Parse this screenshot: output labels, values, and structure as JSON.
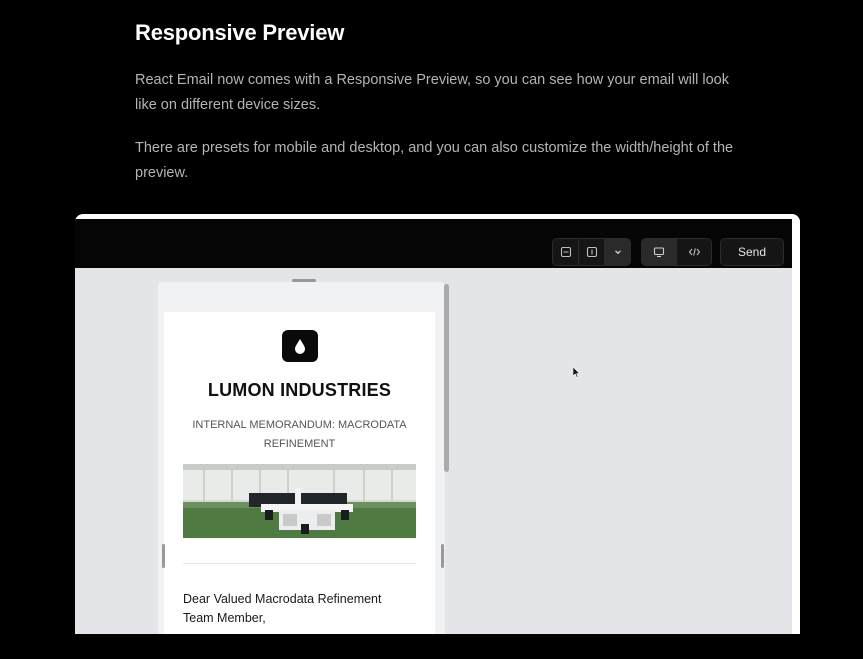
{
  "article": {
    "title": "Responsive Preview",
    "paragraph1": "React Email now comes with a Responsive Preview, so you can see how your email will look like on different device sizes.",
    "paragraph2": "There are presets for mobile and desktop, and you can also customize the width/height of the preview."
  },
  "toolbar": {
    "size_group": {
      "icons": [
        "resize-height-icon",
        "resize-width-icon",
        "chevron-down-icon"
      ]
    },
    "view_group": {
      "icons": [
        "desktop-icon",
        "code-icon"
      ],
      "active": "desktop"
    },
    "send_label": "Send"
  },
  "email": {
    "brand": "LUMON INDUSTRIES",
    "subtitle": "INTERNAL MEMORANDUM: MACRODATA REFINEMENT",
    "image_icon": "office-photo",
    "greeting": "Dear Valued Macrodata Refinement Team Member,"
  },
  "colors": {
    "page_bg": "#000000",
    "canvas_bg": "#e4e5e8",
    "toolbar_bg": "#050505",
    "floor_green": "#4f7a41"
  }
}
